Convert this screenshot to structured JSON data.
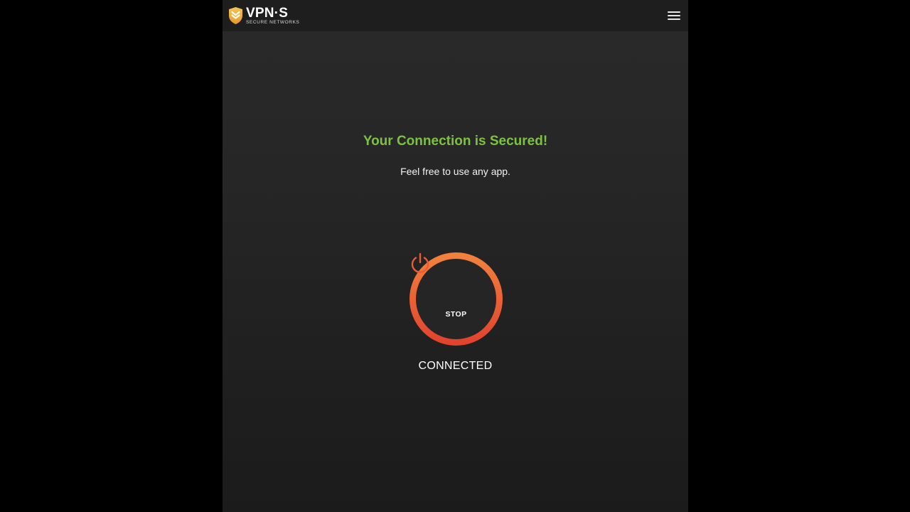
{
  "app": {
    "brand_name": "VPN·S",
    "brand_tagline": "SECURE NETWORKS"
  },
  "header": {
    "menu_icon": "hamburger-menu-icon"
  },
  "main": {
    "headline": "Your Connection is Secured!",
    "subline": "Feel free to use any app.",
    "power_button_label": "STOP",
    "status": "CONNECTED"
  },
  "colors": {
    "background": "#000000",
    "panel": "#262626",
    "topbar": "#1e1e1e",
    "success_green": "#7cc242",
    "ring_orange": "#f07a3a",
    "ring_red": "#e24a2e",
    "logo_gold": "#f2b13c"
  }
}
